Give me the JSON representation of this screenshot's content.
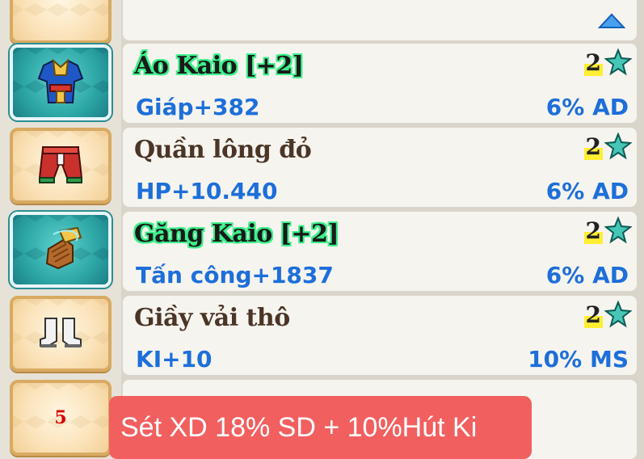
{
  "items": [
    {
      "name": "Áo Kaio [+2]",
      "stat": "Giáp+382",
      "set_bonus": "6% AD",
      "stars": "2",
      "icon": "armor-icon",
      "rare": true
    },
    {
      "name": "Quần lông đỏ",
      "stat": "HP+10.440",
      "set_bonus": "6% AD",
      "stars": "2",
      "icon": "pants-icon",
      "rare": false
    },
    {
      "name": "Găng Kaio [+2]",
      "stat": "Tấn công+1837",
      "set_bonus": "6% AD",
      "stars": "2",
      "icon": "gloves-icon",
      "rare": true
    },
    {
      "name": "Giầy vải thô",
      "stat": "KI+10",
      "set_bonus": "10% MS",
      "stars": "2",
      "icon": "boots-icon",
      "rare": false
    }
  ],
  "bottom_slot_number": "5",
  "toast": "Sét XD 18% SD + 10%Hút Ki",
  "colors": {
    "stat_blue": "#1d6fd9",
    "toast_bg": "#f25f5f",
    "name_glow": "#3cf08a",
    "slot_border": "#d8aa62",
    "rare_slot": "#2da6a6"
  }
}
